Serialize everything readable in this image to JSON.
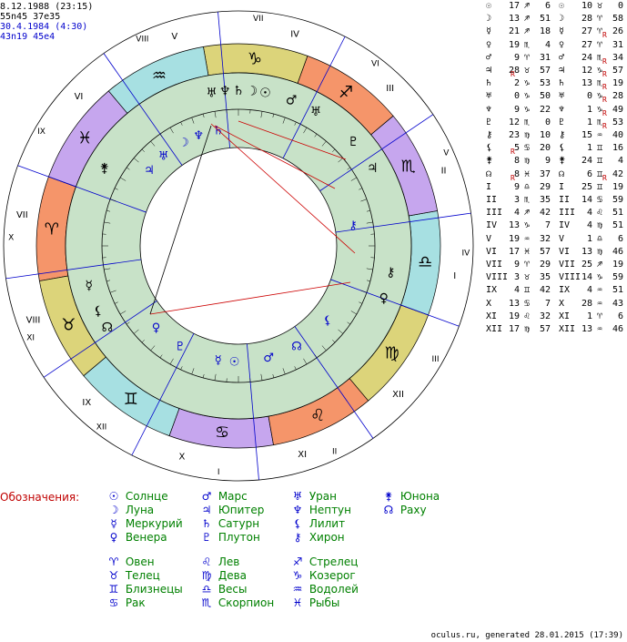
{
  "header": {
    "line1": "8.12.1988 (23:15)",
    "line2": "55n45 37e35",
    "line3": "30.4.1984 (4:30)",
    "line4": "43n19 45e4"
  },
  "colors": {
    "fire": "#f5956a",
    "earth": "#dcd47a",
    "air": "#a7e0e2",
    "water": "#c6a6ee",
    "inner_ring": "#c8e2c8",
    "house_line": "#0000cc",
    "aspect_line": "#cc0000",
    "legend_text": "#008000",
    "legend_glyph": "#0000cc",
    "legend_title": "#c00000"
  },
  "chart": {
    "zodiac_signs": [
      "♈",
      "♉",
      "♊",
      "♋",
      "♌",
      "♍",
      "♎",
      "♏",
      "♐",
      "♑",
      "♒",
      "♓"
    ],
    "outer_houses": [
      "VII",
      "VIII",
      "IX",
      "X",
      "XI",
      "XII",
      "I",
      "II",
      "III",
      "IV",
      "V",
      "VI"
    ],
    "inner_houses": [
      "III",
      "IV",
      "V",
      "VI",
      "VII",
      "VIII",
      "IX",
      "X",
      "XI",
      "XII",
      "I",
      "II"
    ],
    "outer_planets": [
      "♆",
      "♅",
      "☽",
      "♄",
      "☉",
      "♂",
      "♅",
      "♇",
      "♃",
      "⚷",
      "♀",
      "☿",
      "⚸",
      "☊",
      "⚵"
    ],
    "inner_planets": [
      "♆",
      "♄",
      "♅",
      "☽",
      "♃",
      "♀",
      "♇",
      "☿",
      "☉",
      "♂",
      "☊",
      "⚸",
      "⚷"
    ]
  },
  "table": {
    "rows": [
      {
        "g1": "☉",
        "d1": "17",
        "s1": "♐",
        "m1": "6",
        "g2": "☉",
        "d2": "10",
        "s2": "♉",
        "m2": "0",
        "r1": "",
        "r2": ""
      },
      {
        "g1": "☽",
        "d1": "13",
        "s1": "♐",
        "m1": "51",
        "g2": "☽",
        "d2": "28",
        "s2": "♈",
        "m2": "58",
        "r1": "",
        "r2": ""
      },
      {
        "g1": "☿",
        "d1": "21",
        "s1": "♐",
        "m1": "18",
        "g2": "☿",
        "d2": "27",
        "s2": "♈",
        "m2": "26",
        "r1": "",
        "r2": "R"
      },
      {
        "g1": "♀",
        "d1": "19",
        "s1": "♏",
        "m1": "4",
        "g2": "♀",
        "d2": "27",
        "s2": "♈",
        "m2": "31",
        "r1": "",
        "r2": ""
      },
      {
        "g1": "♂",
        "d1": "9",
        "s1": "♈",
        "m1": "31",
        "g2": "♂",
        "d2": "24",
        "s2": "♏",
        "m2": "34",
        "r1": "",
        "r2": "R"
      },
      {
        "g1": "♃",
        "d1": "28",
        "s1": "♉",
        "m1": "57",
        "g2": "♃",
        "d2": "12",
        "s2": "♑",
        "m2": "57",
        "r1": "R",
        "r2": "R"
      },
      {
        "g1": "♄",
        "d1": "2",
        "s1": "♑",
        "m1": "53",
        "g2": "♄",
        "d2": "13",
        "s2": "♏",
        "m2": "19",
        "r1": "",
        "r2": "R"
      },
      {
        "g1": "♅",
        "d1": "0",
        "s1": "♑",
        "m1": "50",
        "g2": "♅",
        "d2": "0",
        "s2": "♑",
        "m2": "28",
        "r1": "",
        "r2": "R"
      },
      {
        "g1": "♆",
        "d1": "9",
        "s1": "♑",
        "m1": "22",
        "g2": "♆",
        "d2": "1",
        "s2": "♑",
        "m2": "49",
        "r1": "",
        "r2": "R"
      },
      {
        "g1": "♇",
        "d1": "12",
        "s1": "♏",
        "m1": "0",
        "g2": "♇",
        "d2": "1",
        "s2": "♏",
        "m2": "53",
        "r1": "",
        "r2": "R"
      },
      {
        "g1": "⚷",
        "d1": "23",
        "s1": "♍",
        "m1": "10",
        "g2": "⚷",
        "d2": "15",
        "s2": "♒",
        "m2": "40",
        "r1": "",
        "r2": ""
      },
      {
        "g1": "⚸",
        "d1": "5",
        "s1": "♋",
        "m1": "20",
        "g2": "⚸",
        "d2": "1",
        "s2": "♊",
        "m2": "16",
        "r1": "R",
        "r2": ""
      },
      {
        "g1": "⚵",
        "d1": "8",
        "s1": "♍",
        "m1": "9",
        "g2": "⚵",
        "d2": "24",
        "s2": "♊",
        "m2": "4",
        "r1": "",
        "r2": ""
      },
      {
        "g1": "☊",
        "d1": "8",
        "s1": "♓",
        "m1": "37",
        "g2": "☊",
        "d2": "6",
        "s2": "♊",
        "m2": "42",
        "r1": "R",
        "r2": "R"
      },
      {
        "g1": "I",
        "d1": "9",
        "s1": "♎",
        "m1": "29",
        "g2": "I",
        "d2": "25",
        "s2": "♊",
        "m2": "19",
        "r1": "",
        "r2": ""
      },
      {
        "g1": "II",
        "d1": "3",
        "s1": "♏",
        "m1": "35",
        "g2": "II",
        "d2": "14",
        "s2": "♋",
        "m2": "59",
        "r1": "",
        "r2": ""
      },
      {
        "g1": "III",
        "d1": "4",
        "s1": "♐",
        "m1": "42",
        "g2": "III",
        "d2": "4",
        "s2": "♌",
        "m2": "51",
        "r1": "",
        "r2": ""
      },
      {
        "g1": "IV",
        "d1": "13",
        "s1": "♑",
        "m1": "7",
        "g2": "IV",
        "d2": "4",
        "s2": "♍",
        "m2": "51",
        "r1": "",
        "r2": ""
      },
      {
        "g1": "V",
        "d1": "19",
        "s1": "♒",
        "m1": "32",
        "g2": "V",
        "d2": "1",
        "s2": "♎",
        "m2": "6",
        "r1": "",
        "r2": ""
      },
      {
        "g1": "VI",
        "d1": "17",
        "s1": "♓",
        "m1": "57",
        "g2": "VI",
        "d2": "13",
        "s2": "♍",
        "m2": "46",
        "r1": "",
        "r2": ""
      },
      {
        "g1": "VII",
        "d1": "9",
        "s1": "♈",
        "m1": "29",
        "g2": "VII",
        "d2": "25",
        "s2": "♐",
        "m2": "19",
        "r1": "",
        "r2": ""
      },
      {
        "g1": "VIII",
        "d1": "3",
        "s1": "♉",
        "m1": "35",
        "g2": "VIII",
        "d2": "14",
        "s2": "♑",
        "m2": "59",
        "r1": "",
        "r2": ""
      },
      {
        "g1": "IX",
        "d1": "4",
        "s1": "♊",
        "m1": "42",
        "g2": "IX",
        "d2": "4",
        "s2": "♒",
        "m2": "51",
        "r1": "",
        "r2": ""
      },
      {
        "g1": "X",
        "d1": "13",
        "s1": "♋",
        "m1": "7",
        "g2": "X",
        "d2": "28",
        "s2": "♒",
        "m2": "43",
        "r1": "",
        "r2": ""
      },
      {
        "g1": "XI",
        "d1": "19",
        "s1": "♌",
        "m1": "32",
        "g2": "XI",
        "d2": "1",
        "s2": "♈",
        "m2": "6",
        "r1": "",
        "r2": ""
      },
      {
        "g1": "XII",
        "d1": "17",
        "s1": "♍",
        "m1": "57",
        "g2": "XII",
        "d2": "13",
        "s2": "♒",
        "m2": "46",
        "r1": "",
        "r2": ""
      }
    ]
  },
  "legend": {
    "title": "Обозначения:",
    "planets": [
      {
        "glyph": "☉",
        "label": "Солнце"
      },
      {
        "glyph": "☽",
        "label": "Луна"
      },
      {
        "glyph": "☿",
        "label": "Меркурий"
      },
      {
        "glyph": "♀",
        "label": "Венера"
      },
      {
        "glyph": "♂",
        "label": "Марс"
      },
      {
        "glyph": "♃",
        "label": "Юпитер"
      },
      {
        "glyph": "♄",
        "label": "Сатурн"
      },
      {
        "glyph": "♇",
        "label": "Плутон"
      },
      {
        "glyph": "♅",
        "label": "Уран"
      },
      {
        "glyph": "♆",
        "label": "Нептун"
      },
      {
        "glyph": "⚸",
        "label": "Лилит"
      },
      {
        "glyph": "⚷",
        "label": "Хирон"
      },
      {
        "glyph": "⚵",
        "label": "Юнона"
      },
      {
        "glyph": "☊",
        "label": "Раху"
      }
    ],
    "signs": [
      {
        "glyph": "♈",
        "label": "Овен"
      },
      {
        "glyph": "♉",
        "label": "Телец"
      },
      {
        "glyph": "♊",
        "label": "Близнецы"
      },
      {
        "glyph": "♋",
        "label": "Рак"
      },
      {
        "glyph": "♌",
        "label": "Лев"
      },
      {
        "glyph": "♍",
        "label": "Дева"
      },
      {
        "glyph": "♎",
        "label": "Весы"
      },
      {
        "glyph": "♏",
        "label": "Скорпион"
      },
      {
        "glyph": "♐",
        "label": "Стрелец"
      },
      {
        "glyph": "♑",
        "label": "Козерог"
      },
      {
        "glyph": "♒",
        "label": "Водолей"
      },
      {
        "glyph": "♓",
        "label": "Рыбы"
      }
    ]
  },
  "footer": "oculus.ru, generated 28.01.2015 (17:39)"
}
